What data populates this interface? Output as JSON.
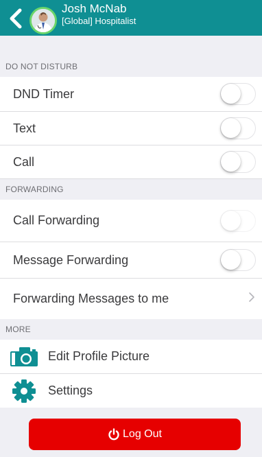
{
  "header": {
    "user_name": "Josh McNab",
    "user_role": "[Global] Hospitalist",
    "background_color": "#0f8f93",
    "back_icon": "chevron-left-icon"
  },
  "sections": {
    "dnd": {
      "title": "DO NOT DISTURB",
      "rows": [
        {
          "label": "DND Timer",
          "toggle_on": false
        },
        {
          "label": "Text",
          "toggle_on": false
        },
        {
          "label": "Call",
          "toggle_on": false
        }
      ]
    },
    "forwarding": {
      "title": "FORWARDING",
      "rows": [
        {
          "label": "Call Forwarding",
          "toggle_on": false,
          "disabled": true
        },
        {
          "label": "Message Forwarding",
          "toggle_on": false
        },
        {
          "label": "Forwarding Messages to me",
          "accessory": "chevron-right-icon"
        }
      ]
    },
    "more": {
      "title": "MORE",
      "rows": [
        {
          "label": "Edit Profile Picture",
          "icon": "camera-icon"
        },
        {
          "label": "Settings",
          "icon": "gear-icon"
        }
      ]
    }
  },
  "logout": {
    "label": "Log Out",
    "icon": "power-icon",
    "color": "#e60000"
  }
}
